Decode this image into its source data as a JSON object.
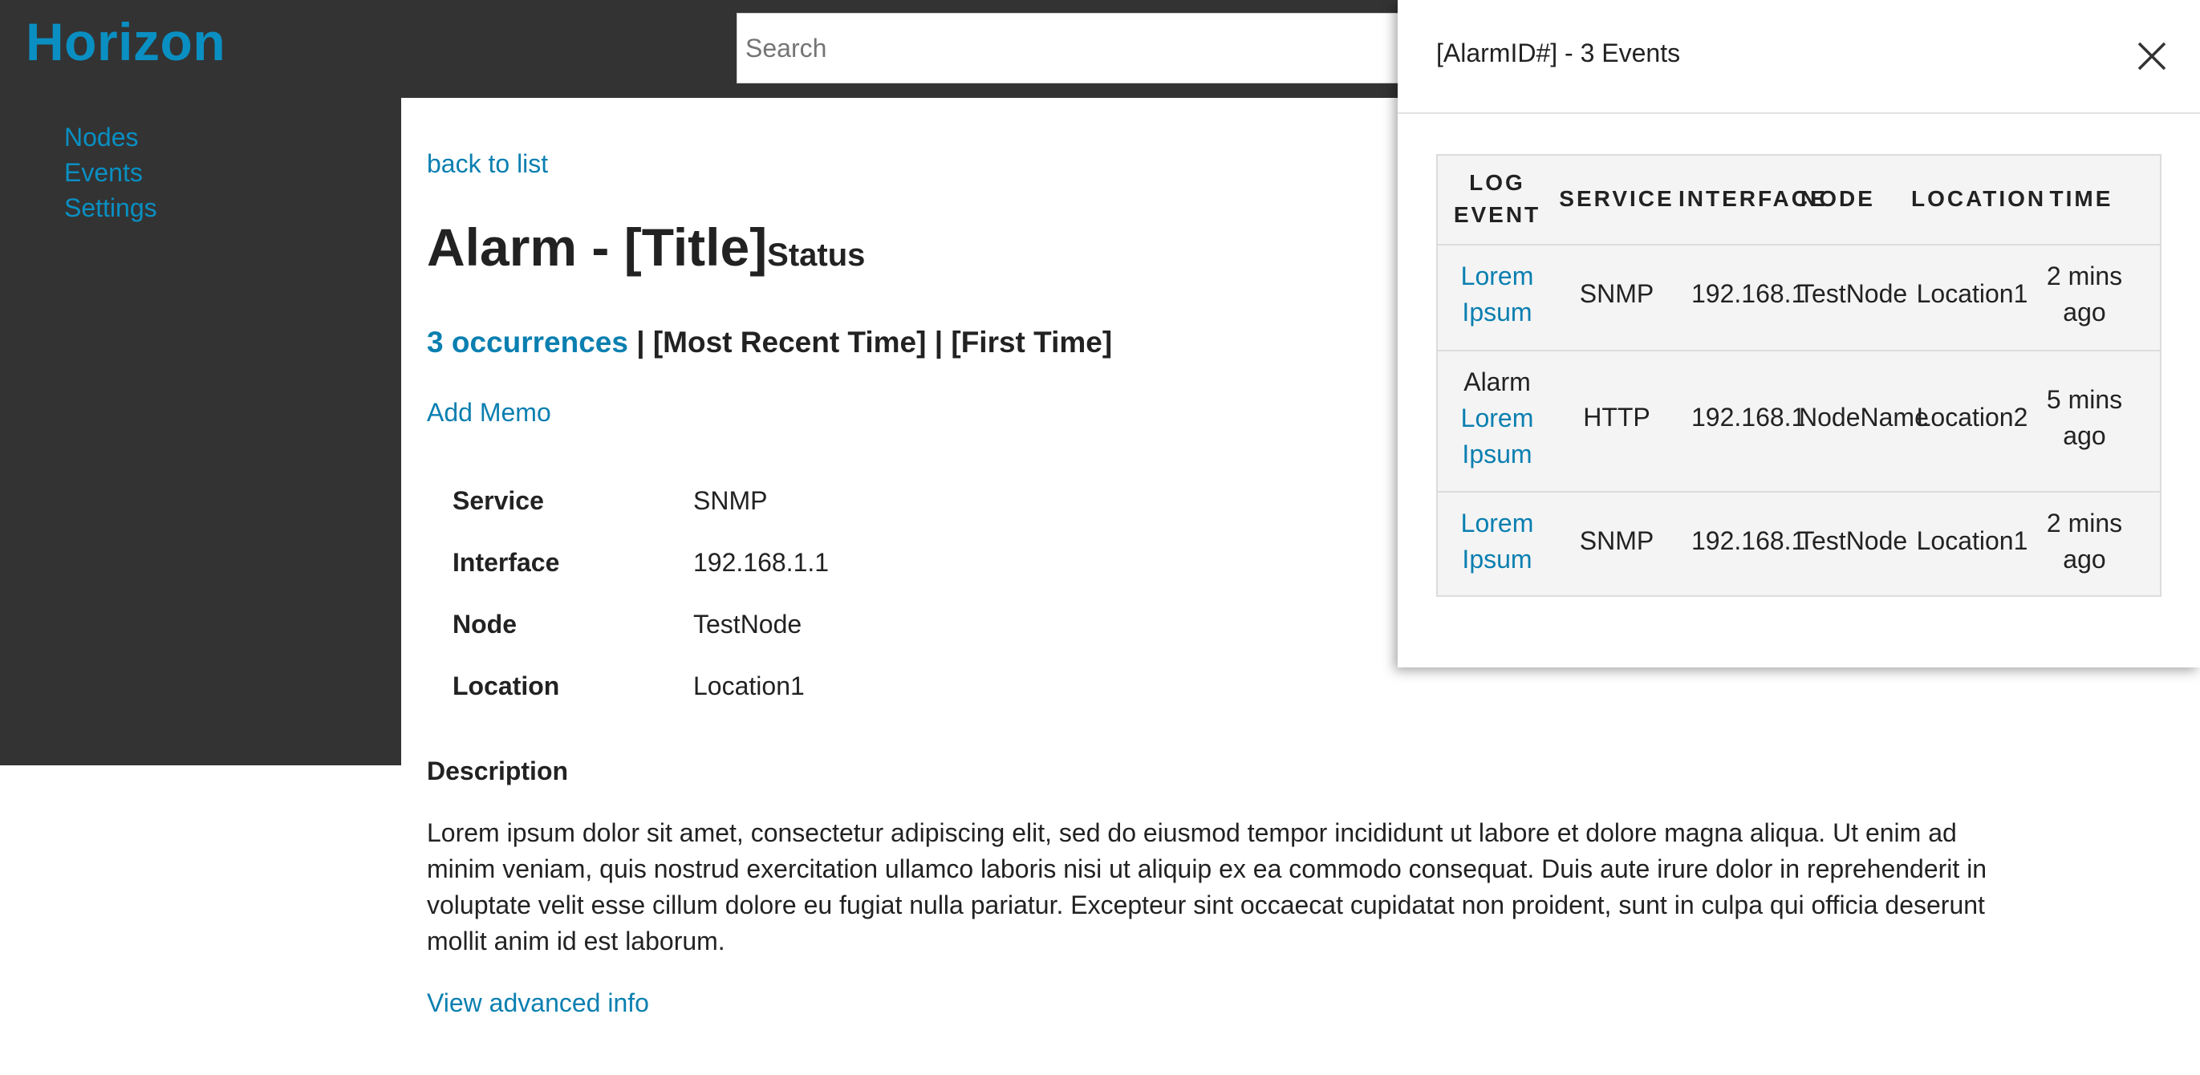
{
  "app": {
    "logo": "Horizon"
  },
  "search": {
    "placeholder": "Search"
  },
  "sidebar": {
    "items": [
      {
        "label": "Nodes"
      },
      {
        "label": "Events"
      },
      {
        "label": "Settings"
      }
    ]
  },
  "main": {
    "back_link": "back to list",
    "title": "Alarm - [Title]",
    "status": "Status",
    "occurrences": "3 occurrences",
    "separator": "|",
    "most_recent": "[Most Recent Time]",
    "first_time": "[First Time]",
    "add_memo": "Add Memo",
    "details": [
      {
        "label": "Service",
        "value": "SNMP"
      },
      {
        "label": "Interface",
        "value": "192.168.1.1"
      },
      {
        "label": "Node",
        "value": "TestNode"
      },
      {
        "label": "Location",
        "value": "Location1"
      }
    ],
    "description_heading": "Description",
    "description": "Lorem ipsum dolor sit amet, consectetur adipiscing elit, sed do eiusmod tempor incididunt ut labore et dolore magna aliqua. Ut enim ad minim veniam, quis nostrud exercitation ullamco laboris nisi ut aliquip ex ea commodo consequat. Duis aute irure dolor in reprehenderit in voluptate velit esse cillum dolore eu fugiat nulla pariatur. Excepteur sint occaecat cupidatat non proident, sunt in culpa qui officia deserunt mollit anim id est laborum.",
    "advanced_link": "View advanced info"
  },
  "drawer": {
    "title": "[AlarmID#] - 3 Events",
    "close_icon": "close-icon",
    "columns": [
      {
        "line1": "LOG",
        "line2": "EVENT"
      },
      {
        "line1": "SERVICE"
      },
      {
        "line1": "INTERFACE"
      },
      {
        "line1": "NODE"
      },
      {
        "line1": "LOCATION"
      },
      {
        "line1": "TIME"
      }
    ],
    "rows": [
      {
        "prefix": "",
        "event_line1": "Lorem",
        "event_line2": "Ipsum",
        "service": "SNMP",
        "interface": "192.168.1.1",
        "node": "TestNode",
        "location": "Location1",
        "time_line1": "2 mins",
        "time_line2": "ago"
      },
      {
        "prefix": "Alarm",
        "event_line1": "Lorem",
        "event_line2": "Ipsum",
        "service": "HTTP",
        "interface": "192.168.1.1",
        "node": "NodeName",
        "location": "Location2",
        "time_line1": "5 mins",
        "time_line2": "ago"
      },
      {
        "prefix": "",
        "event_line1": "Lorem",
        "event_line2": "Ipsum",
        "service": "SNMP",
        "interface": "192.168.1.1",
        "node": "TestNode",
        "location": "Location1",
        "time_line1": "2 mins",
        "time_line2": "ago"
      }
    ]
  },
  "colors": {
    "accent": "#0a7fb0",
    "chrome": "#333333"
  }
}
